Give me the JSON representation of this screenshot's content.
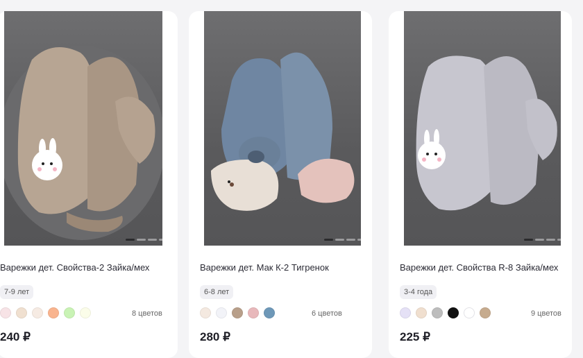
{
  "products": [
    {
      "title": "Варежки дет. Свойства-2 Зайка/мех",
      "age": "7-9 лет",
      "colors_count": "8 цветов",
      "price": "240 ₽",
      "swatches": [
        "#f7e3e6",
        "#f0e0d0",
        "#f6ebe3",
        "#f9b48e",
        "#c9f3b5",
        "#fbfde9"
      ]
    },
    {
      "title": "Варежки дет. Мак К-2 Тигренок",
      "age": "6-8 лет",
      "colors_count": "6 цветов",
      "price": "280 ₽",
      "swatches": [
        "#f4e9e0",
        "#f2f3f8",
        "#b89f8a",
        "#e8b8bb",
        "#6e98b8"
      ]
    },
    {
      "title": "Варежки дет. Свойства R-8 Зайка/мех",
      "age": "3-4 года",
      "colors_count": "9 цветов",
      "price": "225 ₽",
      "swatches": [
        "#e5e1f6",
        "#f0dfcf",
        "#bdbdbd",
        "#111111",
        "#ffffff",
        "#c6ab8e"
      ]
    }
  ]
}
